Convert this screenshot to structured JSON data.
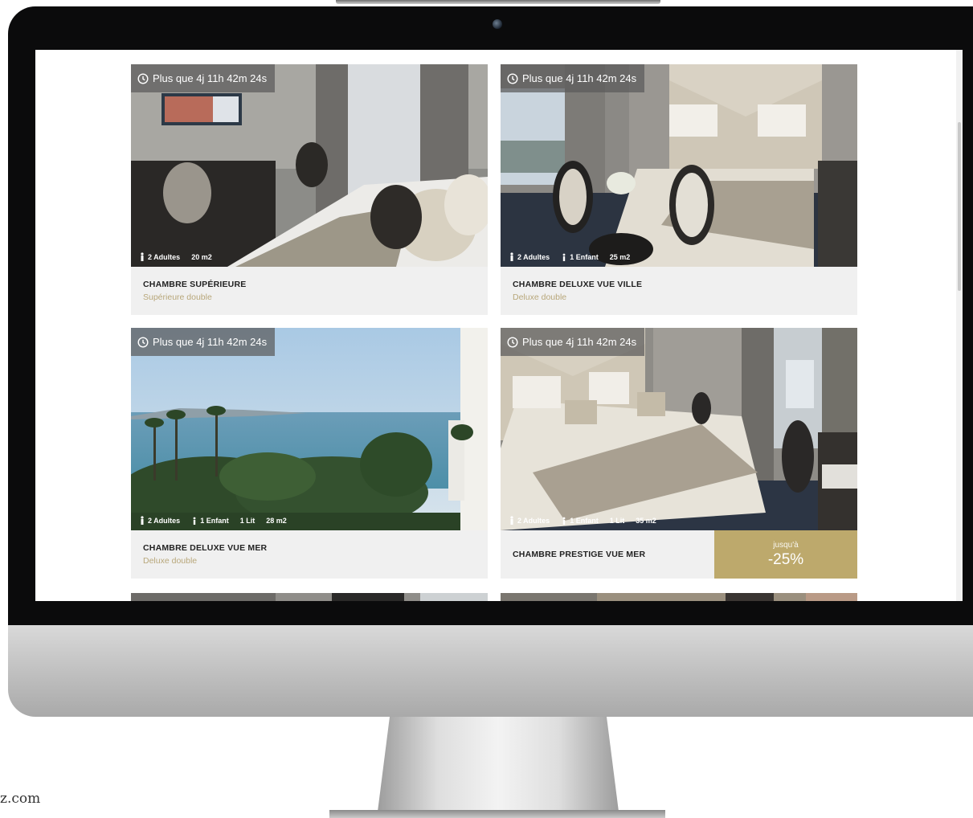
{
  "colors": {
    "accent_gold": "#bda96c",
    "room_type_text": "#b8a77a",
    "card_bg": "#f0f0f0",
    "timer_bg": "#5a5a5a"
  },
  "watermark": "z.com",
  "rooms": [
    {
      "timer": "Plus que 4j 11h 42m 24s",
      "amenities": [
        {
          "icon": "adult-icon",
          "text": "2 Adultes"
        },
        {
          "icon": "",
          "text": "20 m2"
        }
      ],
      "name": "CHAMBRE SUPÉRIEURE",
      "type": "Supérieure double"
    },
    {
      "timer": "Plus que 4j 11h 42m 24s",
      "amenities": [
        {
          "icon": "adult-icon",
          "text": "2 Adultes"
        },
        {
          "icon": "child-icon",
          "text": "1 Enfant"
        },
        {
          "icon": "",
          "text": "25 m2"
        }
      ],
      "name": "CHAMBRE DELUXE VUE VILLE",
      "type": "Deluxe double"
    },
    {
      "timer": "Plus que 4j 11h 42m 24s",
      "amenities": [
        {
          "icon": "adult-icon",
          "text": "2 Adultes"
        },
        {
          "icon": "child-icon",
          "text": "1 Enfant"
        },
        {
          "icon": "",
          "text": "1 Lit"
        },
        {
          "icon": "",
          "text": "28 m2"
        }
      ],
      "name": "CHAMBRE DELUXE VUE MER",
      "type": "Deluxe double"
    },
    {
      "timer": "Plus que 4j 11h 42m 24s",
      "amenities": [
        {
          "icon": "adult-icon",
          "text": "2 Adultes"
        },
        {
          "icon": "child-icon",
          "text": "1 Enfant"
        },
        {
          "icon": "",
          "text": "1 Lit"
        },
        {
          "icon": "",
          "text": "35 m2"
        }
      ],
      "name": "CHAMBRE PRESTIGE VUE MER",
      "type": "",
      "discount": {
        "label": "jusqu'à",
        "value": "-25%"
      }
    }
  ]
}
